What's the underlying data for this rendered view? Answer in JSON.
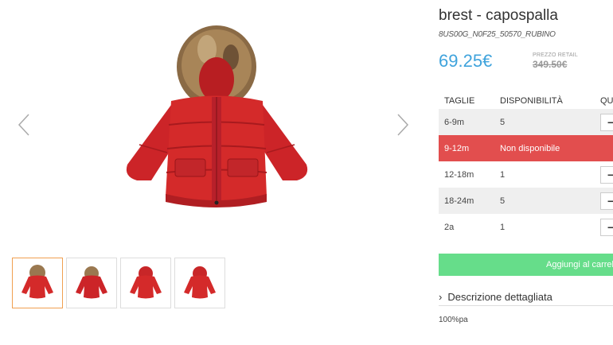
{
  "product": {
    "title": "brest - capospalla",
    "sku": "8US00G_N0F25_50570_RUBINO",
    "price": "69.25€",
    "retail_label": "PREZZO RETAIL",
    "retail_price": "349.50€"
  },
  "sizes_table": {
    "headers": {
      "size": "TAGLIE",
      "availability": "DISPONIBILITÀ",
      "quantity": "QUANTITÀ"
    },
    "rows": [
      {
        "size": "6-9m",
        "availability": "5",
        "qty_symbol": "−"
      },
      {
        "size": "9-12m",
        "availability": "Non disponibile",
        "qty_symbol": ""
      },
      {
        "size": "12-18m",
        "availability": "1",
        "qty_symbol": "−"
      },
      {
        "size": "18-24m",
        "availability": "5",
        "qty_symbol": "−"
      },
      {
        "size": "2a",
        "availability": "1",
        "qty_symbol": "−"
      }
    ]
  },
  "actions": {
    "add_to_cart": "Aggiungi al carrello"
  },
  "description": {
    "toggle_label": "Descrizione dettagliata",
    "text": "100%pa"
  },
  "gallery": {
    "thumbnail_count": 4,
    "active_thumbnail": 1
  },
  "colors": {
    "price": "#3fa3dc",
    "unavailable": "#e24e4e",
    "cart": "#66dd8a",
    "jacket": "#d42a2a",
    "active_thumb": "#f0a050"
  },
  "icons": {
    "prev": "chevron-left-icon",
    "next": "chevron-right-icon",
    "expand": "chevron-right-icon"
  }
}
